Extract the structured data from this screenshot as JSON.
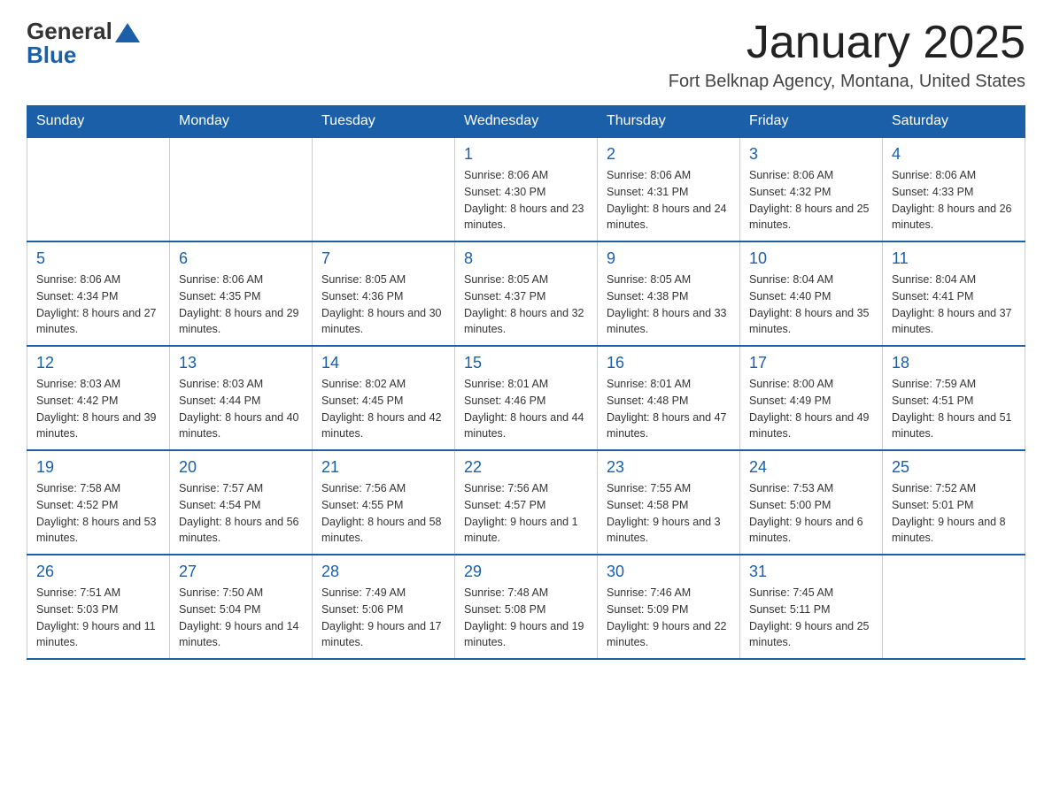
{
  "header": {
    "title": "January 2025",
    "subtitle": "Fort Belknap Agency, Montana, United States",
    "logo_general": "General",
    "logo_blue": "Blue"
  },
  "weekdays": [
    "Sunday",
    "Monday",
    "Tuesday",
    "Wednesday",
    "Thursday",
    "Friday",
    "Saturday"
  ],
  "weeks": [
    [
      {
        "day": "",
        "sunrise": "",
        "sunset": "",
        "daylight": ""
      },
      {
        "day": "",
        "sunrise": "",
        "sunset": "",
        "daylight": ""
      },
      {
        "day": "",
        "sunrise": "",
        "sunset": "",
        "daylight": ""
      },
      {
        "day": "1",
        "sunrise": "Sunrise: 8:06 AM",
        "sunset": "Sunset: 4:30 PM",
        "daylight": "Daylight: 8 hours and 23 minutes."
      },
      {
        "day": "2",
        "sunrise": "Sunrise: 8:06 AM",
        "sunset": "Sunset: 4:31 PM",
        "daylight": "Daylight: 8 hours and 24 minutes."
      },
      {
        "day": "3",
        "sunrise": "Sunrise: 8:06 AM",
        "sunset": "Sunset: 4:32 PM",
        "daylight": "Daylight: 8 hours and 25 minutes."
      },
      {
        "day": "4",
        "sunrise": "Sunrise: 8:06 AM",
        "sunset": "Sunset: 4:33 PM",
        "daylight": "Daylight: 8 hours and 26 minutes."
      }
    ],
    [
      {
        "day": "5",
        "sunrise": "Sunrise: 8:06 AM",
        "sunset": "Sunset: 4:34 PM",
        "daylight": "Daylight: 8 hours and 27 minutes."
      },
      {
        "day": "6",
        "sunrise": "Sunrise: 8:06 AM",
        "sunset": "Sunset: 4:35 PM",
        "daylight": "Daylight: 8 hours and 29 minutes."
      },
      {
        "day": "7",
        "sunrise": "Sunrise: 8:05 AM",
        "sunset": "Sunset: 4:36 PM",
        "daylight": "Daylight: 8 hours and 30 minutes."
      },
      {
        "day": "8",
        "sunrise": "Sunrise: 8:05 AM",
        "sunset": "Sunset: 4:37 PM",
        "daylight": "Daylight: 8 hours and 32 minutes."
      },
      {
        "day": "9",
        "sunrise": "Sunrise: 8:05 AM",
        "sunset": "Sunset: 4:38 PM",
        "daylight": "Daylight: 8 hours and 33 minutes."
      },
      {
        "day": "10",
        "sunrise": "Sunrise: 8:04 AM",
        "sunset": "Sunset: 4:40 PM",
        "daylight": "Daylight: 8 hours and 35 minutes."
      },
      {
        "day": "11",
        "sunrise": "Sunrise: 8:04 AM",
        "sunset": "Sunset: 4:41 PM",
        "daylight": "Daylight: 8 hours and 37 minutes."
      }
    ],
    [
      {
        "day": "12",
        "sunrise": "Sunrise: 8:03 AM",
        "sunset": "Sunset: 4:42 PM",
        "daylight": "Daylight: 8 hours and 39 minutes."
      },
      {
        "day": "13",
        "sunrise": "Sunrise: 8:03 AM",
        "sunset": "Sunset: 4:44 PM",
        "daylight": "Daylight: 8 hours and 40 minutes."
      },
      {
        "day": "14",
        "sunrise": "Sunrise: 8:02 AM",
        "sunset": "Sunset: 4:45 PM",
        "daylight": "Daylight: 8 hours and 42 minutes."
      },
      {
        "day": "15",
        "sunrise": "Sunrise: 8:01 AM",
        "sunset": "Sunset: 4:46 PM",
        "daylight": "Daylight: 8 hours and 44 minutes."
      },
      {
        "day": "16",
        "sunrise": "Sunrise: 8:01 AM",
        "sunset": "Sunset: 4:48 PM",
        "daylight": "Daylight: 8 hours and 47 minutes."
      },
      {
        "day": "17",
        "sunrise": "Sunrise: 8:00 AM",
        "sunset": "Sunset: 4:49 PM",
        "daylight": "Daylight: 8 hours and 49 minutes."
      },
      {
        "day": "18",
        "sunrise": "Sunrise: 7:59 AM",
        "sunset": "Sunset: 4:51 PM",
        "daylight": "Daylight: 8 hours and 51 minutes."
      }
    ],
    [
      {
        "day": "19",
        "sunrise": "Sunrise: 7:58 AM",
        "sunset": "Sunset: 4:52 PM",
        "daylight": "Daylight: 8 hours and 53 minutes."
      },
      {
        "day": "20",
        "sunrise": "Sunrise: 7:57 AM",
        "sunset": "Sunset: 4:54 PM",
        "daylight": "Daylight: 8 hours and 56 minutes."
      },
      {
        "day": "21",
        "sunrise": "Sunrise: 7:56 AM",
        "sunset": "Sunset: 4:55 PM",
        "daylight": "Daylight: 8 hours and 58 minutes."
      },
      {
        "day": "22",
        "sunrise": "Sunrise: 7:56 AM",
        "sunset": "Sunset: 4:57 PM",
        "daylight": "Daylight: 9 hours and 1 minute."
      },
      {
        "day": "23",
        "sunrise": "Sunrise: 7:55 AM",
        "sunset": "Sunset: 4:58 PM",
        "daylight": "Daylight: 9 hours and 3 minutes."
      },
      {
        "day": "24",
        "sunrise": "Sunrise: 7:53 AM",
        "sunset": "Sunset: 5:00 PM",
        "daylight": "Daylight: 9 hours and 6 minutes."
      },
      {
        "day": "25",
        "sunrise": "Sunrise: 7:52 AM",
        "sunset": "Sunset: 5:01 PM",
        "daylight": "Daylight: 9 hours and 8 minutes."
      }
    ],
    [
      {
        "day": "26",
        "sunrise": "Sunrise: 7:51 AM",
        "sunset": "Sunset: 5:03 PM",
        "daylight": "Daylight: 9 hours and 11 minutes."
      },
      {
        "day": "27",
        "sunrise": "Sunrise: 7:50 AM",
        "sunset": "Sunset: 5:04 PM",
        "daylight": "Daylight: 9 hours and 14 minutes."
      },
      {
        "day": "28",
        "sunrise": "Sunrise: 7:49 AM",
        "sunset": "Sunset: 5:06 PM",
        "daylight": "Daylight: 9 hours and 17 minutes."
      },
      {
        "day": "29",
        "sunrise": "Sunrise: 7:48 AM",
        "sunset": "Sunset: 5:08 PM",
        "daylight": "Daylight: 9 hours and 19 minutes."
      },
      {
        "day": "30",
        "sunrise": "Sunrise: 7:46 AM",
        "sunset": "Sunset: 5:09 PM",
        "daylight": "Daylight: 9 hours and 22 minutes."
      },
      {
        "day": "31",
        "sunrise": "Sunrise: 7:45 AM",
        "sunset": "Sunset: 5:11 PM",
        "daylight": "Daylight: 9 hours and 25 minutes."
      },
      {
        "day": "",
        "sunrise": "",
        "sunset": "",
        "daylight": ""
      }
    ]
  ]
}
